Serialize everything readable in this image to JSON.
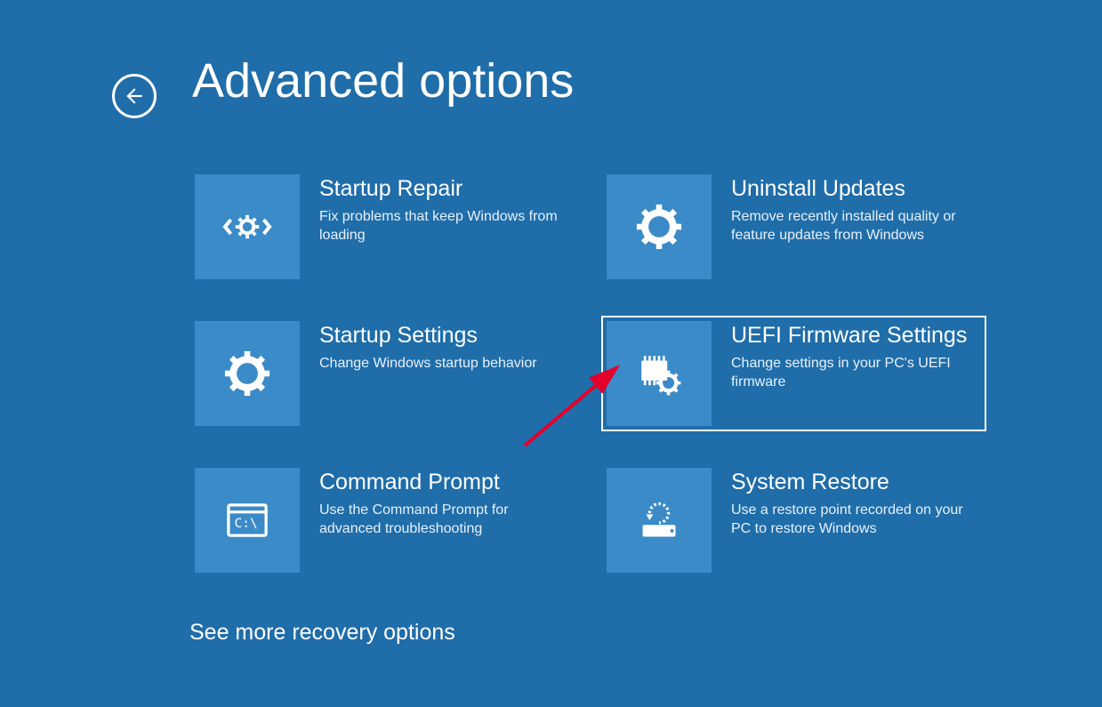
{
  "page_title": "Advanced options",
  "more_link": "See more recovery options",
  "tiles": [
    {
      "title": "Startup Repair",
      "desc": "Fix problems that keep Windows from loading"
    },
    {
      "title": "Uninstall Updates",
      "desc": "Remove recently installed quality or feature updates from Windows"
    },
    {
      "title": "Startup Settings",
      "desc": "Change Windows startup behavior"
    },
    {
      "title": "UEFI Firmware Settings",
      "desc": "Change settings in your PC's UEFI firmware"
    },
    {
      "title": "Command Prompt",
      "desc": "Use the Command Prompt for advanced troubleshooting"
    },
    {
      "title": "System Restore",
      "desc": "Use a restore point recorded on your PC to restore Windows"
    }
  ]
}
